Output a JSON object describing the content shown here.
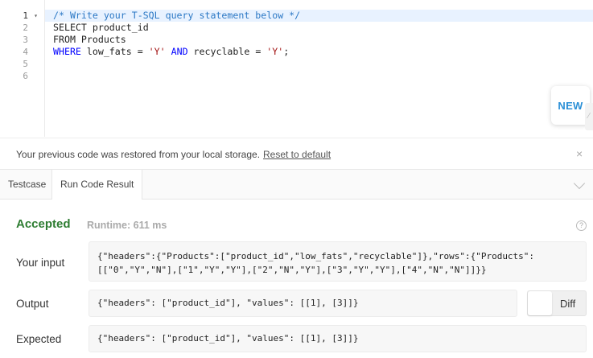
{
  "editor": {
    "line_numbers": [
      "1",
      "2",
      "3",
      "4",
      "5",
      "6"
    ],
    "lines": [
      {
        "parts": [
          {
            "t": "/* Write your T-SQL query statement below */",
            "c": "cm"
          }
        ]
      },
      {
        "parts": [
          {
            "t": "SELECT",
            "c": ""
          },
          {
            "t": " product_id",
            "c": ""
          }
        ]
      },
      {
        "parts": [
          {
            "t": "FROM",
            "c": ""
          },
          {
            "t": " Products",
            "c": ""
          }
        ]
      },
      {
        "parts": [
          {
            "t": "WHERE",
            "c": "kw"
          },
          {
            "t": " low_fats = ",
            "c": ""
          },
          {
            "t": "'Y'",
            "c": "str"
          },
          {
            "t": " ",
            "c": ""
          },
          {
            "t": "AND",
            "c": "kw"
          },
          {
            "t": " recyclable = ",
            "c": ""
          },
          {
            "t": "'Y'",
            "c": "str"
          },
          {
            "t": ";",
            "c": ""
          }
        ]
      },
      {
        "parts": []
      },
      {
        "parts": []
      }
    ],
    "new_button": "NEW"
  },
  "restore": {
    "message": "Your previous code was restored from your local storage.",
    "link": "Reset to default",
    "close": "×"
  },
  "tabs": {
    "testcase": "Testcase",
    "run_result": "Run Code Result"
  },
  "result": {
    "status": "Accepted",
    "runtime": "Runtime: 611 ms",
    "help": "?",
    "input_label": "Your input",
    "input_value": "{\"headers\":{\"Products\":[\"product_id\",\"low_fats\",\"recyclable\"]},\"rows\":{\"Products\":\n[[\"0\",\"Y\",\"N\"],[\"1\",\"Y\",\"Y\"],[\"2\",\"N\",\"Y\"],[\"3\",\"Y\",\"Y\"],[\"4\",\"N\",\"N\"]]}}",
    "output_label": "Output",
    "output_value": "{\"headers\": [\"product_id\"], \"values\": [[1], [3]]}",
    "diff_label": "Diff",
    "expected_label": "Expected",
    "expected_value": "{\"headers\": [\"product_id\"], \"values\": [[1], [3]]}"
  },
  "colors": {
    "accepted": "#2e7d32",
    "new_button": "#2a8fd6",
    "keyword": "#0000ff",
    "comment": "#2b78c5",
    "string": "#a31515"
  }
}
